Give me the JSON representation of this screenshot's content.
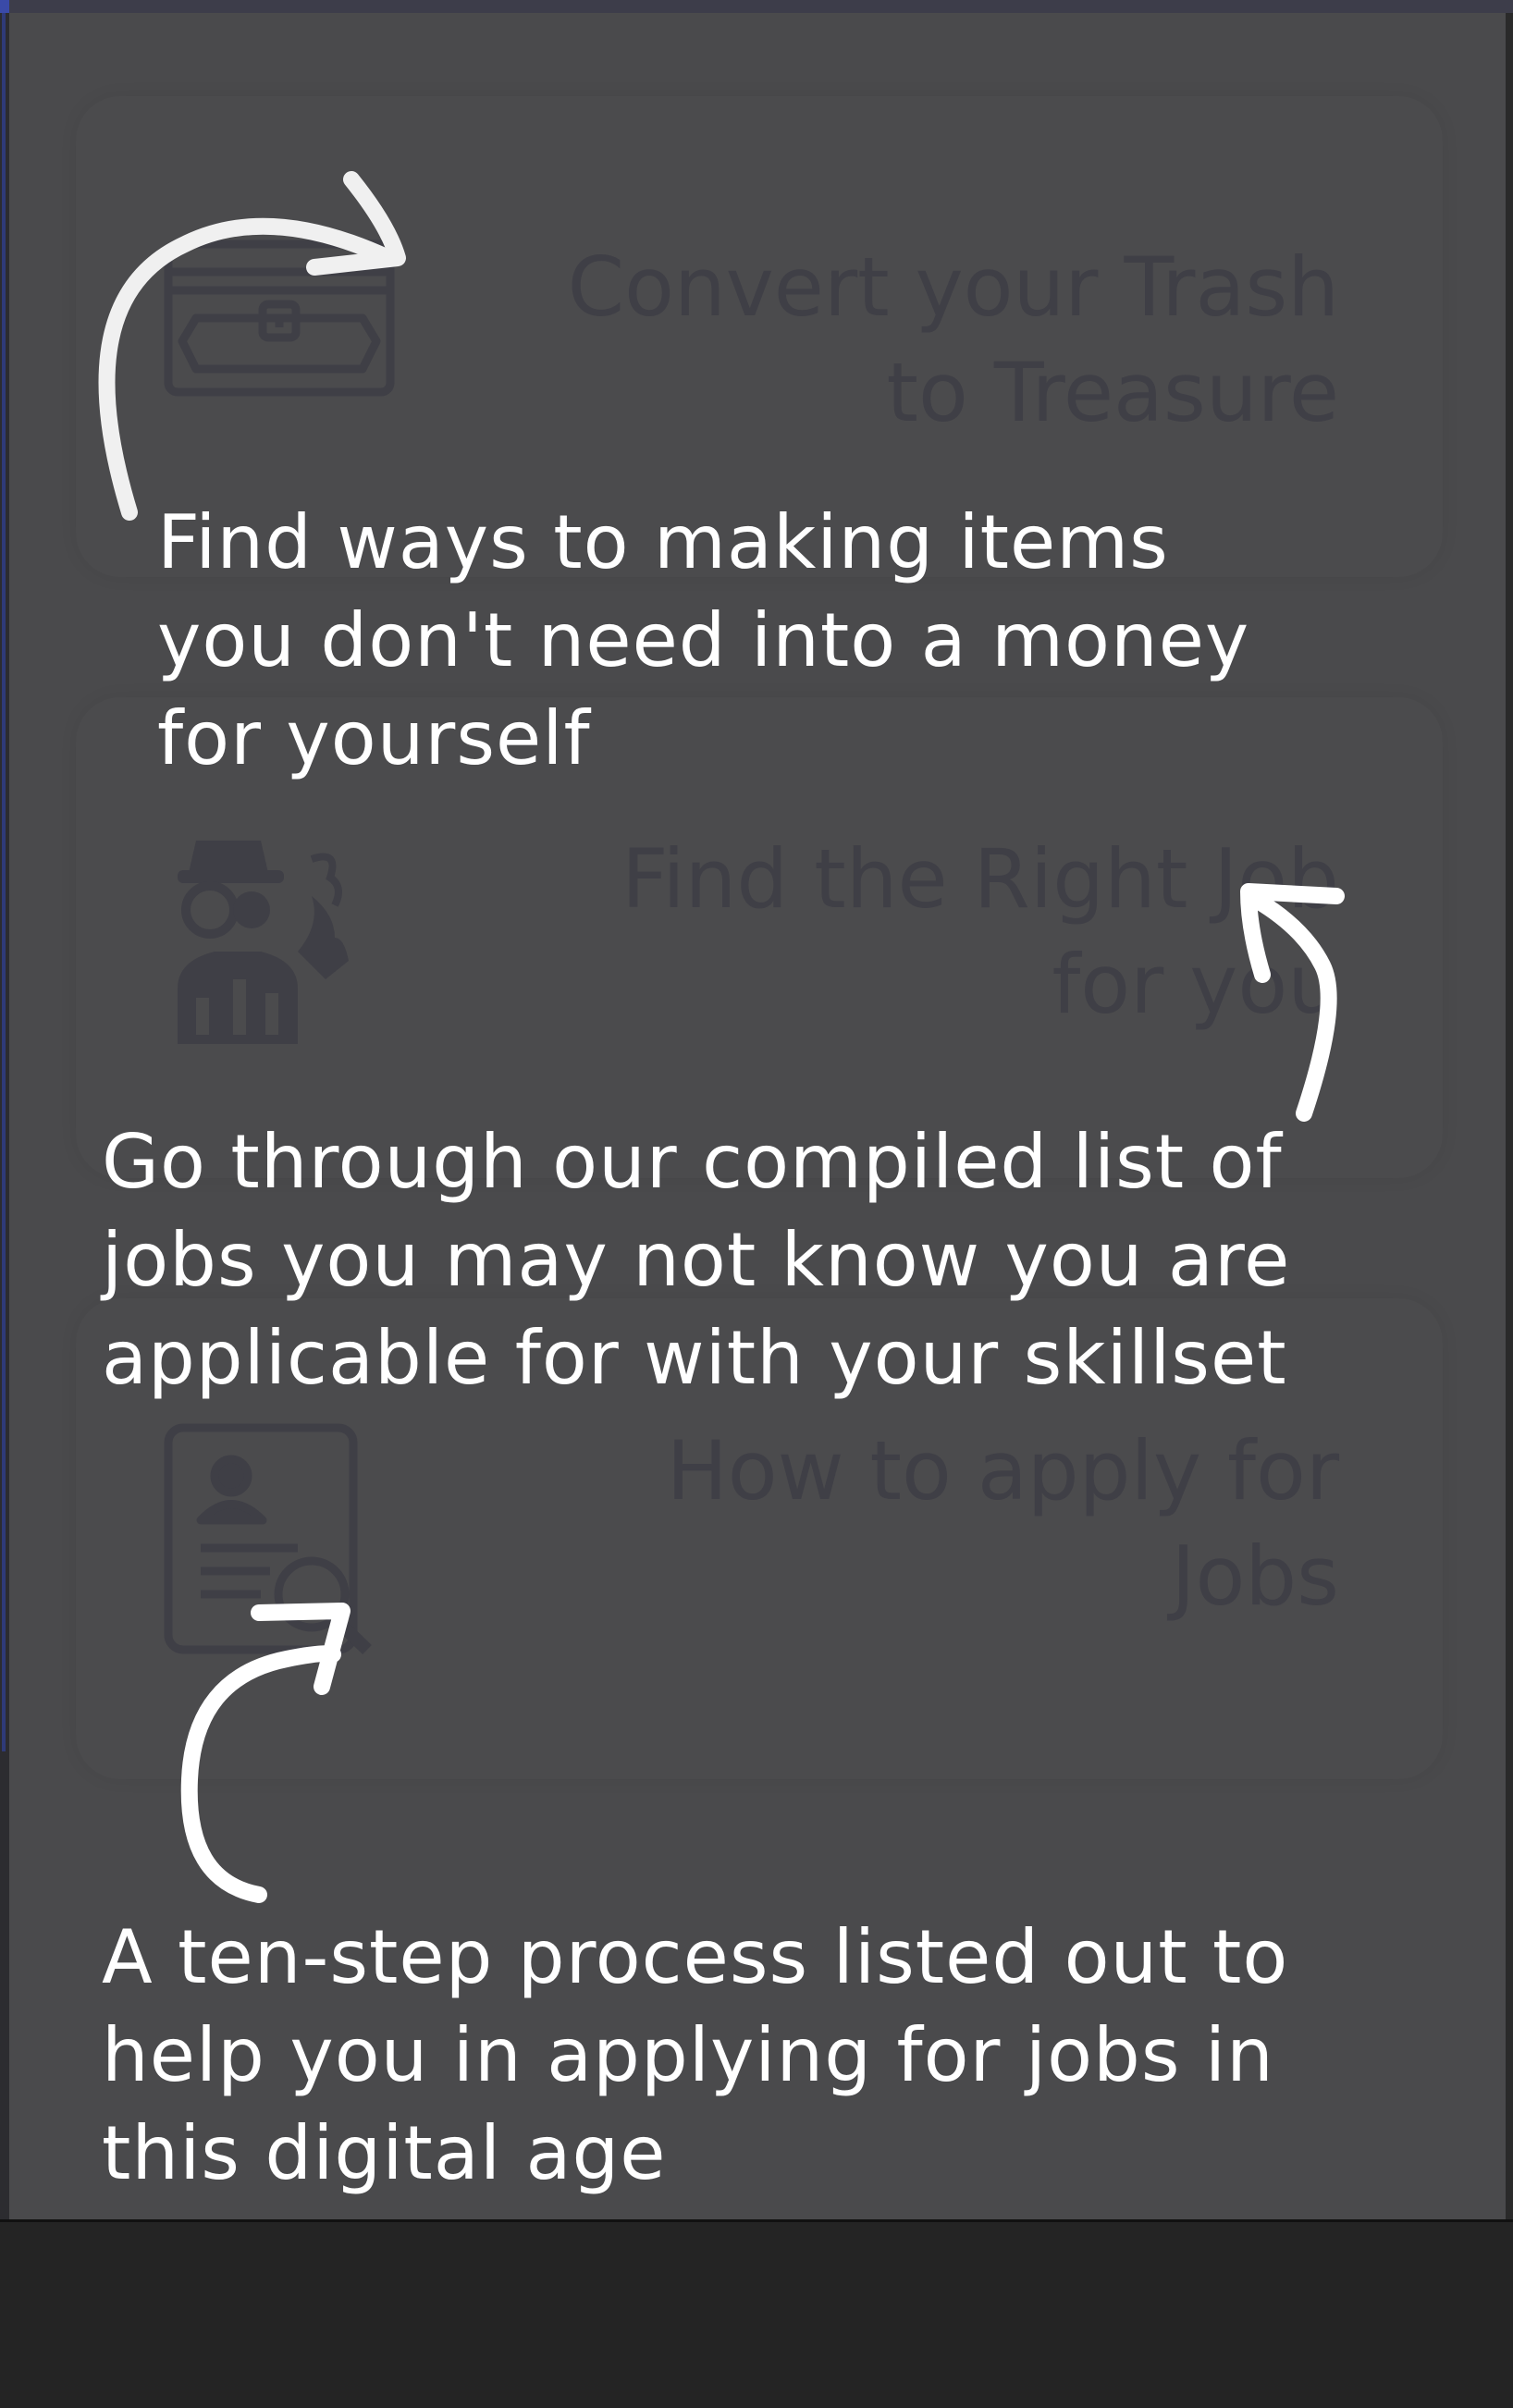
{
  "cards": [
    {
      "title": "Convert your Trash\nto Treasure",
      "icon": "treasure-chest-icon"
    },
    {
      "title": "Find the Right Job\nfor you",
      "icon": "detective-icon"
    },
    {
      "title": "How to apply for\nJobs",
      "icon": "resume-search-icon"
    }
  ],
  "coachmarks": [
    {
      "text": "Find ways to making items\nyou don't need into a money\nfor yourself"
    },
    {
      "text": "Go through our compiled list of\njobs you may not know you are\napplicable for with your skillset"
    },
    {
      "text": "A ten-step process listed out to\nhelp you in applying for jobs in\nthis digital age"
    }
  ],
  "colors": {
    "overlay": "#4a4a4c",
    "card_text": "#3f3f46",
    "coach_text": "#ffffff",
    "bottom_bar": "#242424"
  }
}
